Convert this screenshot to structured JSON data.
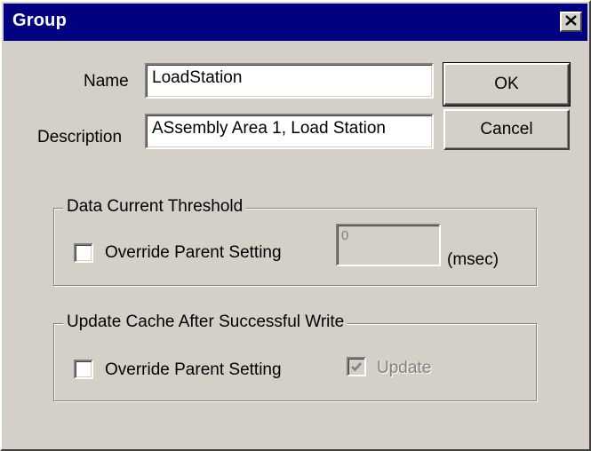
{
  "window": {
    "title": "Group",
    "close_icon": "close-icon"
  },
  "form": {
    "name_label": "Name",
    "name_value": "LoadStation",
    "description_label": "Description",
    "description_value": "ASsembly Area 1, Load Station"
  },
  "buttons": {
    "ok": "OK",
    "cancel": "Cancel"
  },
  "data_current_threshold": {
    "title": "Data Current Threshold",
    "override_label": "Override Parent Setting",
    "override_checked": false,
    "value": "0",
    "unit": "(msec)"
  },
  "update_cache": {
    "title": "Update Cache After Successful Write",
    "override_label": "Override Parent Setting",
    "override_checked": false,
    "update_label": "Update",
    "update_checked": true,
    "update_enabled": false
  },
  "colors": {
    "titlebar": "#000080",
    "face": "#d4d0c8",
    "disabled_text": "#808080"
  }
}
